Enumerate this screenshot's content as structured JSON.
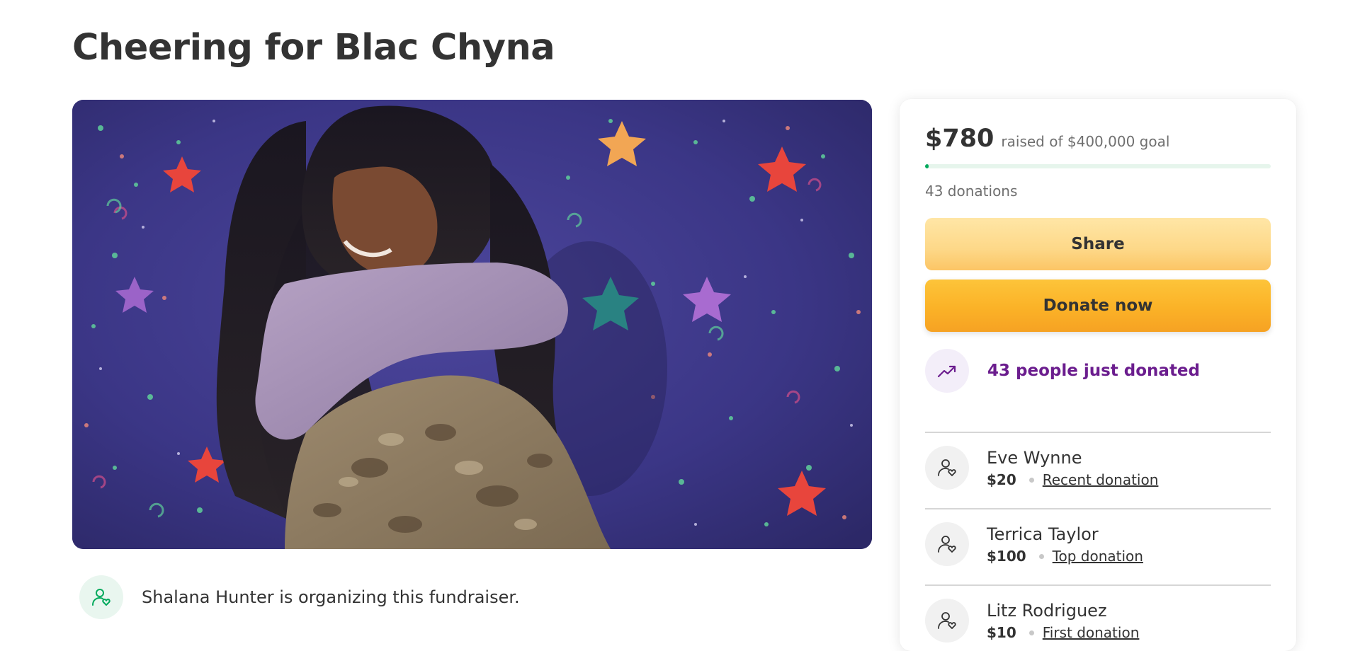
{
  "page": {
    "title": "Cheering for Blac Chyna"
  },
  "hero": {
    "alt": "Two people hugging in front of a starry mural"
  },
  "organizer": {
    "text": "Shalana Hunter is organizing this fundraiser.",
    "icon": "person-heart-icon"
  },
  "donation_panel": {
    "raised_amount": "$780",
    "raised_label": "raised of $400,000 goal",
    "progress_fraction": 0.00195,
    "donations_count": "43 donations",
    "share_label": "Share",
    "donate_label": "Donate now",
    "trend_text": "43 people just donated",
    "trend_icon": "trending-up-icon",
    "donors": [
      {
        "name": "Eve Wynne",
        "amount": "$20",
        "type": "Recent donation"
      },
      {
        "name": "Terrica Taylor",
        "amount": "$100",
        "type": "Top donation"
      },
      {
        "name": "Litz Rodriguez",
        "amount": "$10",
        "type": "First donation"
      }
    ]
  },
  "colors": {
    "progress": "#02a95c",
    "trend_purple": "#6b1d8e",
    "donate_orange": "#fbb227",
    "share_yellow": "#fdd888"
  }
}
